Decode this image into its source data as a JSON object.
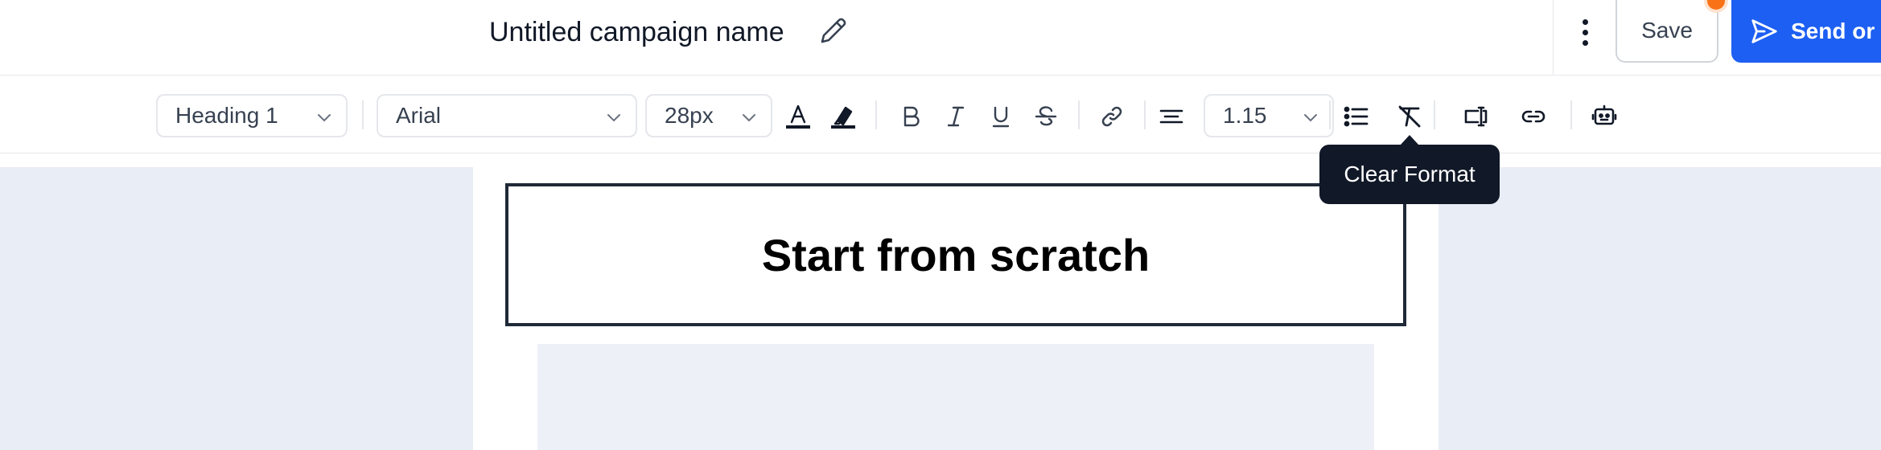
{
  "header": {
    "campaign_title": "Untitled campaign name",
    "edit_icon": "pencil-icon",
    "more_icon": "kebab-vertical-icon",
    "save_label": "Save",
    "send_label": "Send or",
    "send_icon": "paper-plane-icon",
    "notification_color": "#f97316",
    "accent_color": "#1d5ff2"
  },
  "toolbar": {
    "block_type": "Heading 1",
    "font_family": "Arial",
    "font_size": "28px",
    "line_height": "1.15",
    "buttons": [
      {
        "name": "text-color",
        "icon": "text-color-icon"
      },
      {
        "name": "highlight",
        "icon": "highlighter-icon"
      },
      {
        "name": "bold",
        "icon": "bold-icon"
      },
      {
        "name": "italic",
        "icon": "italic-icon"
      },
      {
        "name": "underline",
        "icon": "underline-icon"
      },
      {
        "name": "strikethrough",
        "icon": "strikethrough-icon"
      },
      {
        "name": "link",
        "icon": "link-icon"
      },
      {
        "name": "align-center",
        "icon": "align-center-icon"
      },
      {
        "name": "bullet-list",
        "icon": "bullet-list-icon"
      },
      {
        "name": "clear-format",
        "icon": "clear-format-icon"
      },
      {
        "name": "button-block",
        "icon": "button-insert-icon"
      },
      {
        "name": "link-block",
        "icon": "link-chain-icon"
      },
      {
        "name": "ai-assistant",
        "icon": "robot-icon"
      }
    ]
  },
  "tooltip": {
    "text": "Clear Format"
  },
  "email": {
    "heading": "Start from scratch"
  }
}
